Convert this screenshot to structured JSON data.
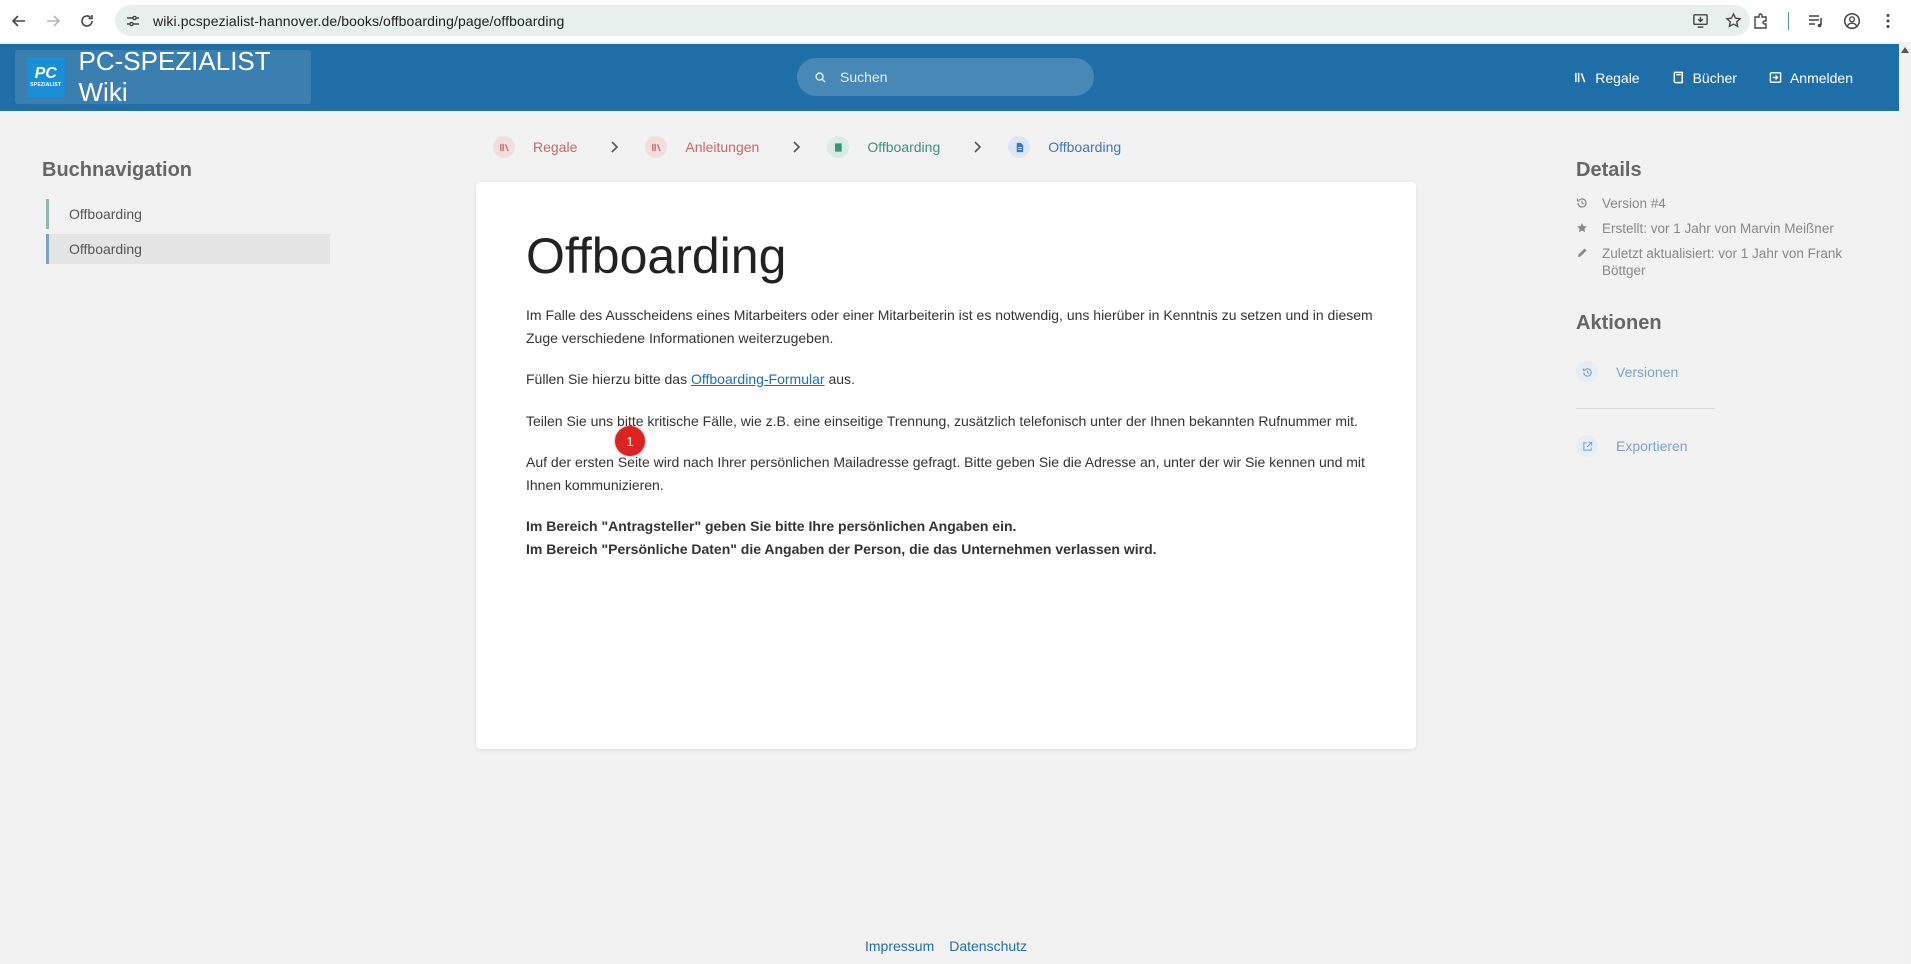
{
  "browser": {
    "url": "wiki.pcspezialist-hannover.de/books/offboarding/page/offboarding"
  },
  "header": {
    "logo_line1": "PC",
    "logo_line2": "SPEZIALIST",
    "site_title": "PC-SPEZIALIST Wiki",
    "search_placeholder": "Suchen",
    "links": {
      "shelves": "Regale",
      "books": "Bücher",
      "login": "Anmelden"
    }
  },
  "book_nav": {
    "title": "Buchnavigation",
    "items": [
      {
        "label": "Offboarding"
      },
      {
        "label": "Offboarding"
      }
    ]
  },
  "breadcrumbs": [
    {
      "label": "Regale",
      "type": "shelf",
      "icon": "shelves-icon"
    },
    {
      "label": "Anleitungen",
      "type": "shelf",
      "icon": "shelves-icon"
    },
    {
      "label": "Offboarding",
      "type": "book",
      "icon": "book-icon"
    },
    {
      "label": "Offboarding",
      "type": "page",
      "icon": "page-icon"
    }
  ],
  "page": {
    "title": "Offboarding",
    "para1": "Im Falle des Ausscheidens eines Mitarbeiters oder einer Mitarbeiterin ist es notwendig, uns hierüber in Kenntnis zu setzen und in diesem Zuge verschiedene Informationen weiterzugeben.",
    "para2_before": "Füllen Sie hierzu bitte das ",
    "para2_link": "Offboarding-Formular",
    "para2_after": " aus.",
    "para3": "Teilen Sie uns bitte kritische Fälle, wie z.B. eine einseitige Trennung, zusätzlich telefonisch unter der Ihnen bekannten Rufnummer mit.",
    "para4": "Auf der ersten Seite wird nach Ihrer persönlichen Mailadresse gefragt. Bitte geben Sie die Adresse an, unter der wir Sie kennen und mit Ihnen kommunizieren.",
    "bold1": "Im Bereich \"Antragsteller\" geben Sie bitte Ihre persönlichen Angaben ein.",
    "bold2": "Im Bereich \"Persönliche Daten\" die Angaben der Person, die das Unternehmen verlassen wird.",
    "marker_label": "1"
  },
  "details": {
    "title": "Details",
    "version": "Version #4",
    "created": "Erstellt: vor 1 Jahr von Marvin Meißner",
    "updated": "Zuletzt aktualisiert: vor 1 Jahr von Frank Böttger"
  },
  "actions": {
    "title": "Aktionen",
    "revisions": "Versionen",
    "export": "Exportieren"
  },
  "footer": {
    "imprint": "Impressum",
    "privacy": "Datenschutz"
  },
  "colors": {
    "header_bg": "#206ea7",
    "shelf": "#c46767",
    "book": "#3f8f7a",
    "page": "#3d78b0",
    "marker": "#dd2222"
  }
}
